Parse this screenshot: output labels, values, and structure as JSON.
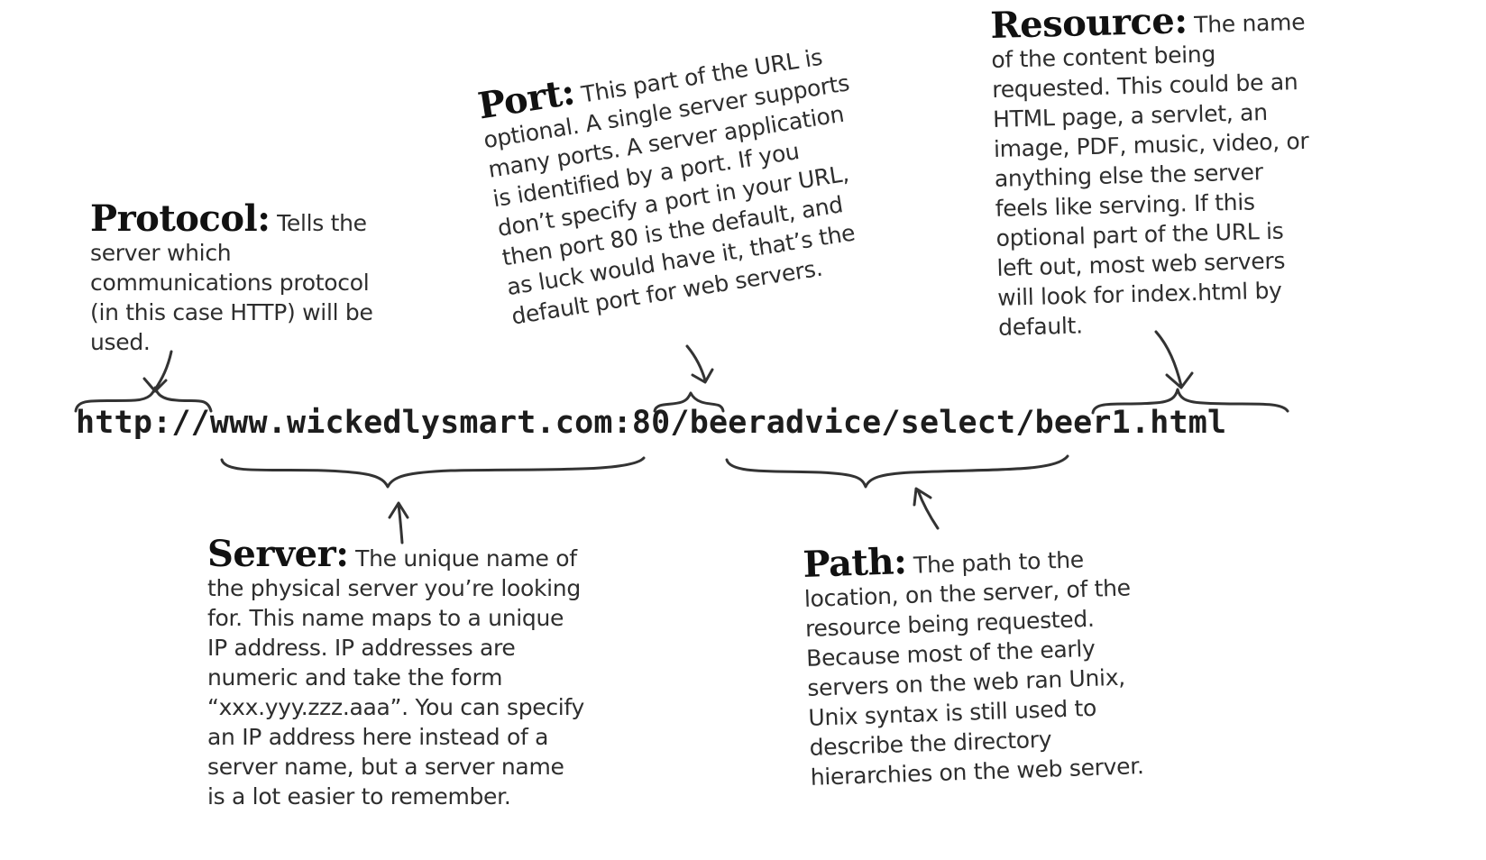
{
  "url": "http://www.wickedlysmart.com:80/beeradvice/select/beer1.html",
  "annotations": {
    "protocol": {
      "term": "Protocol",
      "text": "Tells the server which communications protocol (in this case HTTP) will be used."
    },
    "port": {
      "term": "Port",
      "text": "This part of the URL is optional. A single server supports many ports. A server application is identified by a port. If you don’t specify a port in your URL, then port 80 is the default, and as luck would have it, that’s the default port for web servers."
    },
    "resource": {
      "term": "Resource",
      "text": "The name of the content being requested. This could be an HTML page, a servlet, an image, PDF, music, video, or anything else the server feels like serving. If this optional part of the URL is left out, most web servers will look for index.html by default."
    },
    "server": {
      "term": "Server",
      "text": "The unique name of the physical server you’re looking for. This name maps to a unique IP address. IP addresses are numeric and take the form “xxx.yyy.zzz.aaa”. You can specify an IP address here instead of a server name, but a server name is a lot easier to remember."
    },
    "path": {
      "term": "Path",
      "text": "The path to the location, on the server, of the resource being requested. Because most of the early servers on the web ran Unix, Unix syntax is still used to describe the directory hierarchies on the web server."
    }
  }
}
